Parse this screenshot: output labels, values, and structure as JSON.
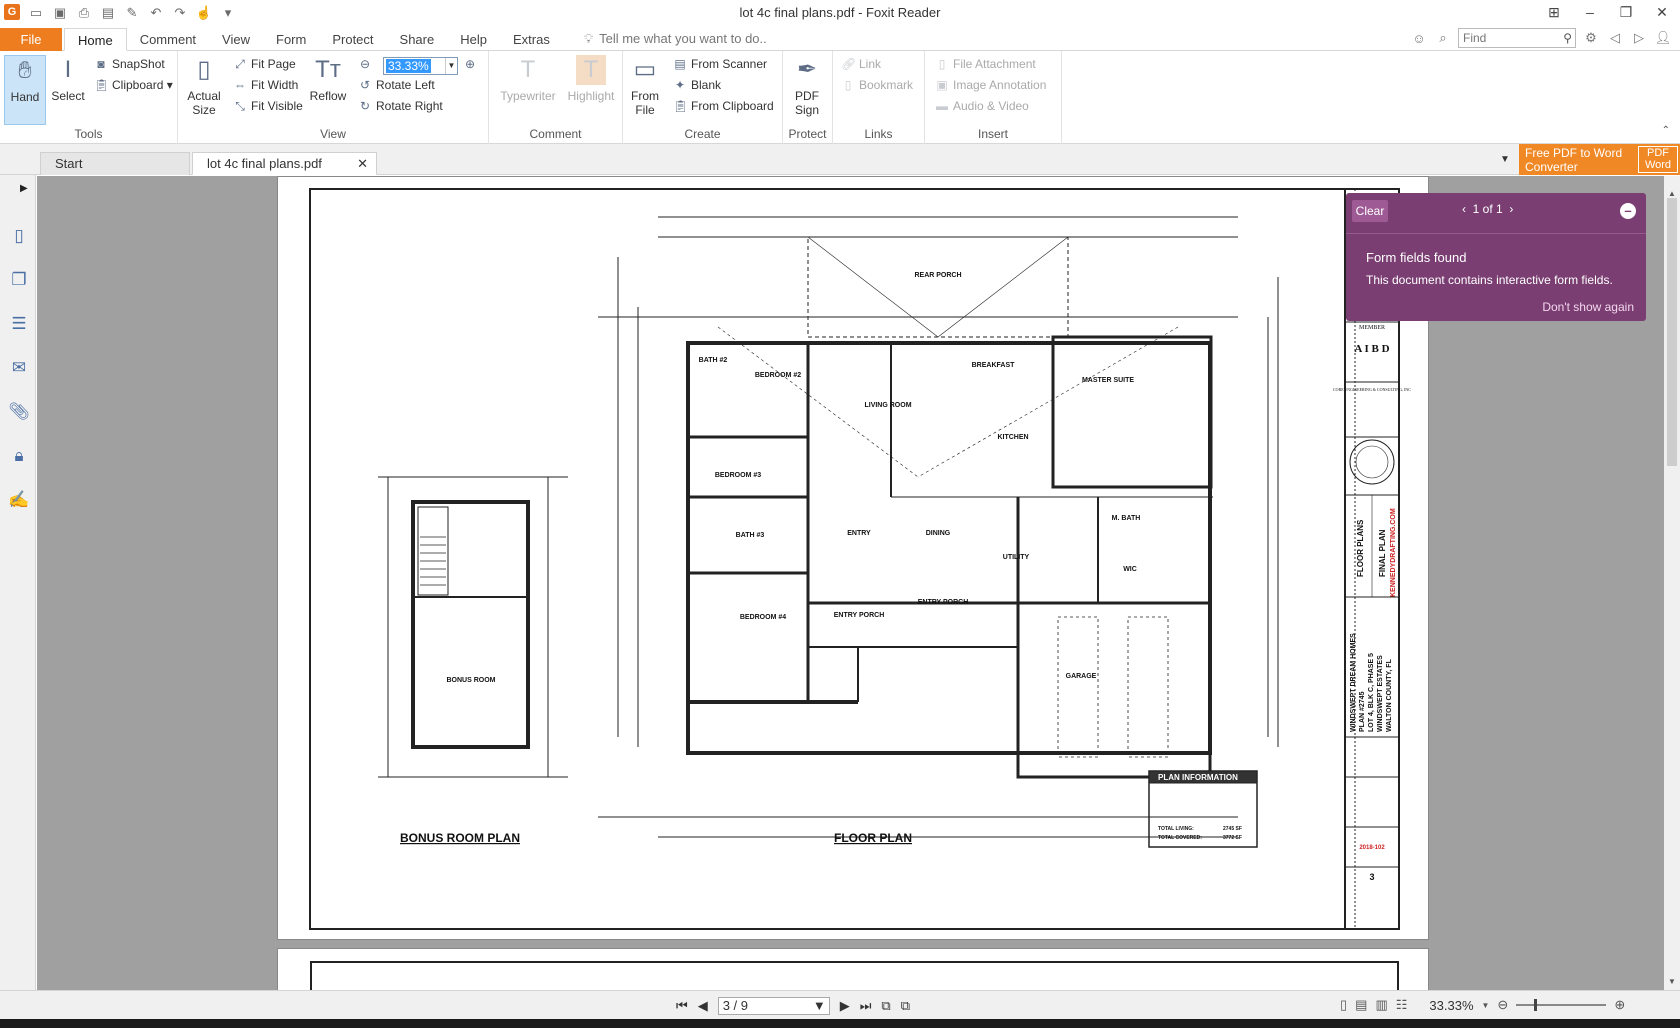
{
  "app": {
    "title": "lot 4c final plans.pdf - Foxit Reader",
    "icon": "foxit-logo"
  },
  "menu": {
    "file": "File",
    "tabs": [
      "Home",
      "Comment",
      "View",
      "Form",
      "Protect",
      "Share",
      "Help",
      "Extras"
    ],
    "tell_me": "Tell me what you want to do..",
    "find_placeholder": "Find"
  },
  "ribbon": {
    "tools": {
      "label": "Tools",
      "hand": "Hand",
      "select": "Select",
      "snapshot": "SnapShot",
      "clipboard": "Clipboard"
    },
    "view": {
      "label": "View",
      "actual_size_1": "Actual",
      "actual_size_2": "Size",
      "fit_page": "Fit Page",
      "fit_width": "Fit Width",
      "fit_visible": "Fit Visible",
      "reflow": "Reflow",
      "zoom_value": "33.33%",
      "rotate_left": "Rotate Left",
      "rotate_right": "Rotate Right"
    },
    "comment": {
      "label": "Comment",
      "typewriter": "Typewriter",
      "highlight": "Highlight"
    },
    "create": {
      "label": "Create",
      "from_file_1": "From",
      "from_file_2": "File",
      "from_scanner": "From Scanner",
      "blank": "Blank",
      "from_clipboard": "From Clipboard"
    },
    "protect": {
      "label": "Protect",
      "pdf_sign_1": "PDF",
      "pdf_sign_2": "Sign"
    },
    "links": {
      "label": "Links",
      "link": "Link",
      "bookmark": "Bookmark"
    },
    "insert": {
      "label": "Insert",
      "file_attachment": "File Attachment",
      "image_annotation": "Image Annotation",
      "audio_video": "Audio & Video"
    }
  },
  "doc_tabs": {
    "start": "Start",
    "file": "lot 4c final plans.pdf"
  },
  "promo": {
    "line1": "Free PDF to Word",
    "line2": "Converter",
    "badge1": "PDF",
    "badge2": "Word"
  },
  "notification": {
    "clear": "Clear",
    "pager": "1 of 1",
    "title": "Form fields found",
    "message": "This document contains interactive form fields.",
    "dismiss": "Don't show again"
  },
  "plan": {
    "rooms": {
      "rear_porch": "REAR PORCH",
      "bath2": "BATH #2",
      "bedroom2": "BEDROOM #2",
      "living": "LIVING ROOM",
      "breakfast": "BREAKFAST",
      "master_suite": "MASTER SUITE",
      "kitchen": "KITCHEN",
      "bedroom3": "BEDROOM #3",
      "bath3": "BATH #3",
      "entry": "ENTRY",
      "dining": "DINING",
      "utility": "UTILITY",
      "m_bath": "M. BATH",
      "wic": "WIC",
      "bedroom4": "BEDROOM #4",
      "entry_porch_1": "ENTRY PORCH",
      "entry_porch_2": "ENTRY PORCH",
      "garage": "GARAGE",
      "bonus_room": "BONUS ROOM"
    },
    "bonus_title": "BONUS ROOM PLAN",
    "floor_title": "FLOOR PLAN",
    "info": {
      "header": "PLAN INFORMATION",
      "total_living_label": "TOTAL LIVING:",
      "total_living": "2745 SF",
      "total_covered_label": "TOTAL COVERED:",
      "total_covered": "3772 SF"
    },
    "title_block": {
      "member": "MEMBER",
      "aibd": "A I B D",
      "core": "CORE ENGINEERING & CONSULTING, INC",
      "floor_plans": "FLOOR PLANS",
      "final_plan": "FINAL PLAN",
      "website": "KENNEDYDRAFTING.COM",
      "client1": "WINDSWEPT DREAM HOMES",
      "client2": "PLAN #2745",
      "client3": "LOT 4, BLK C, PHASE 5",
      "client4": "WINDSWEPT ESTATES",
      "client5": "WALTON COUNTY, FL",
      "project_no": "2018-102",
      "sheet": "3"
    }
  },
  "status": {
    "page": "3 / 9",
    "zoom": "33.33%"
  },
  "colors": {
    "accent": "#ed7d1f",
    "notification_bg": "#7a3e72",
    "ribbon_selected": "#cce4f7"
  }
}
